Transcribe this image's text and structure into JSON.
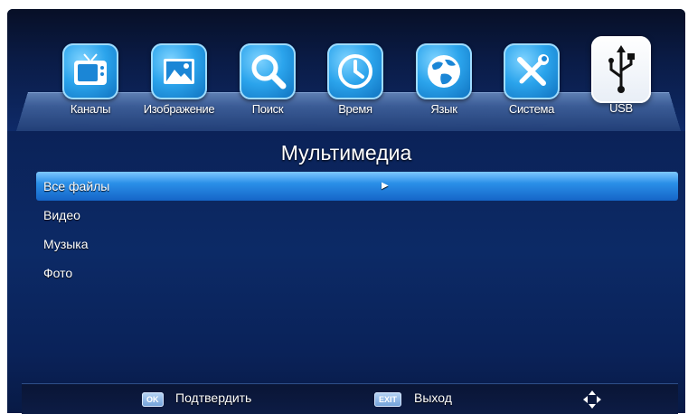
{
  "menu": {
    "items": [
      {
        "label": "Каналы",
        "icon": "tv-icon"
      },
      {
        "label": "Изображение",
        "icon": "picture-icon"
      },
      {
        "label": "Поиск",
        "icon": "search-icon"
      },
      {
        "label": "Время",
        "icon": "clock-icon"
      },
      {
        "label": "Язык",
        "icon": "globe-icon"
      },
      {
        "label": "Система",
        "icon": "tools-icon"
      },
      {
        "label": "USB",
        "icon": "usb-icon"
      }
    ],
    "selected": "USB"
  },
  "page_title": "Мультимедиа",
  "list": {
    "items": [
      "Все файлы",
      "Видео",
      "Музыка",
      "Фото"
    ],
    "selected": "Все файлы"
  },
  "footer": {
    "ok_key": "OK",
    "ok_label": "Подтвердить",
    "exit_key": "EXIT",
    "exit_label": "Выход",
    "nav_icon": "navigation-arrows-icon"
  },
  "colors": {
    "background": "#0b2258",
    "highlight": "#2a8fe8",
    "icon_blue": "#2ba4ec"
  }
}
